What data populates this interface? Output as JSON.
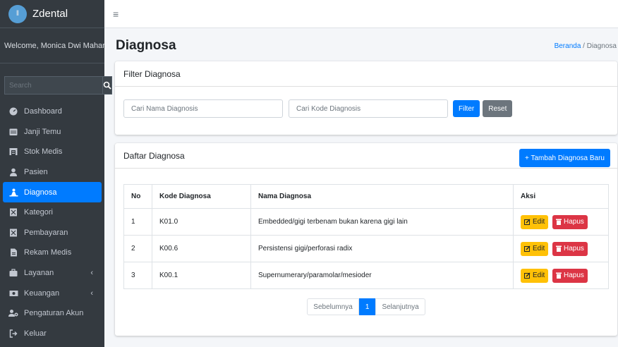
{
  "brand": {
    "name": "Zdental"
  },
  "user_panel": {
    "welcome": "Welcome, Monica Dwi Maharani"
  },
  "sidebar": {
    "search_placeholder": "Search",
    "items": [
      {
        "label": "Dashboard",
        "icon": "tachometer-icon"
      },
      {
        "label": "Janji Temu",
        "icon": "calendar-icon"
      },
      {
        "label": "Stok Medis",
        "icon": "warehouse-icon"
      },
      {
        "label": "Pasien",
        "icon": "user-icon"
      },
      {
        "label": "Diagnosa",
        "icon": "diagnose-icon",
        "active": true
      },
      {
        "label": "Kategori",
        "icon": "tag-icon"
      },
      {
        "label": "Pembayaran",
        "icon": "payment-icon"
      },
      {
        "label": "Rekam Medis",
        "icon": "file-icon"
      },
      {
        "label": "Layanan",
        "icon": "briefcase-icon",
        "chevron": "‹"
      },
      {
        "label": "Keuangan",
        "icon": "money-icon",
        "chevron": "‹"
      },
      {
        "label": "Pengaturan Akun",
        "icon": "users-cog-icon"
      },
      {
        "label": "Keluar",
        "icon": "sign-out-icon"
      }
    ]
  },
  "topbar": {
    "menu_icon": "≡"
  },
  "header": {
    "title": "Diagnosa",
    "breadcrumb_home": "Beranda",
    "breadcrumb_sep": "/",
    "breadcrumb_current": "Diagnosa"
  },
  "filter": {
    "title": "Filter Diagnosa",
    "name_placeholder": "Cari Nama Diagnosis",
    "code_placeholder": "Cari Kode Diagnosis",
    "filter_label": "Filter",
    "reset_label": "Reset"
  },
  "list": {
    "title": "Daftar Diagnosa",
    "add_label": "+ Tambah Diagnosa Baru",
    "columns": [
      "No",
      "Kode Diagnosa",
      "Nama Diagnosa",
      "Aksi"
    ],
    "rows": [
      {
        "no": "1",
        "code": "K01.0",
        "name": "Embedded/gigi terbenam bukan karena gigi lain"
      },
      {
        "no": "2",
        "code": "K00.6",
        "name": "Persistensi gigi/perforasi radix"
      },
      {
        "no": "3",
        "code": "K00.1",
        "name": "Supernumerary/paramolar/mesioder"
      }
    ],
    "edit_label": "Edit",
    "delete_label": "Hapus"
  },
  "pagination": {
    "prev": "Sebelumnya",
    "current": "1",
    "next": "Selanjutnya"
  },
  "colors": {
    "sidebar_bg": "#343a40",
    "primary": "#007bff",
    "warning": "#ffc107",
    "danger": "#dc3545",
    "secondary": "#6c757d"
  }
}
